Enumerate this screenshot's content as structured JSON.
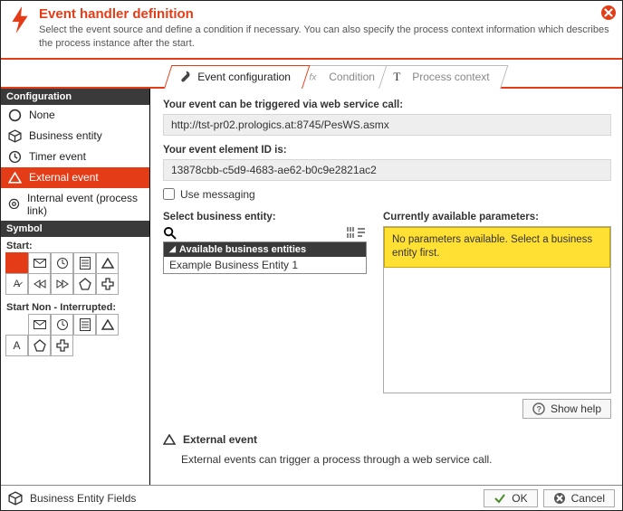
{
  "header": {
    "title": "Event handler definition",
    "subtitle": "Select the event source and define a condition if necessary. You can also specify the process context information which describes the process instance after the start."
  },
  "tabs": {
    "config": "Event configuration",
    "condition": "Condition",
    "context": "Process context"
  },
  "sidebar": {
    "config_header": "Configuration",
    "items": [
      {
        "label": "None"
      },
      {
        "label": "Business entity"
      },
      {
        "label": "Timer event"
      },
      {
        "label": "External event"
      },
      {
        "label": "Internal event (process link)"
      }
    ],
    "symbol_header": "Symbol",
    "start_label": "Start:",
    "start_noninterrupt_label": "Start Non - Interrupted:"
  },
  "main": {
    "ws_label": "Your event can be triggered via web service call:",
    "ws_url": "http://tst-pr02.prologics.at:8745/PesWS.asmx",
    "eid_label": "Your event element ID is:",
    "eid_value": "13878cbb-c5d9-4683-ae62-b0c9e2821ac2",
    "use_messaging": "Use messaging",
    "select_entity_label": "Select business entity:",
    "entity_header": "Available business entities",
    "entity_rows": [
      "Example Business Entity 1"
    ],
    "params_label": "Currently available parameters:",
    "params_empty": "No parameters available. Select a business entity first.",
    "show_help": "Show help",
    "ext_title": "External event",
    "ext_desc": "External events can trigger a process through a web service call."
  },
  "footer": {
    "left": "Business Entity Fields",
    "ok": "OK",
    "cancel": "Cancel"
  }
}
